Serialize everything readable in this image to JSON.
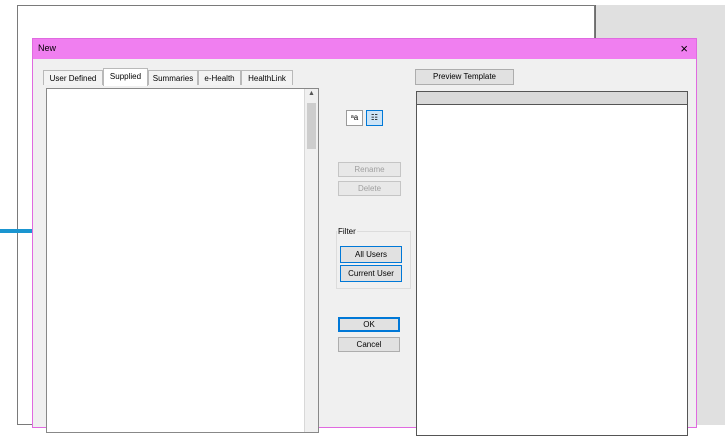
{
  "dialog": {
    "title": "New",
    "close_glyph": "×"
  },
  "tabs": [
    {
      "label": "User Defined",
      "active": false
    },
    {
      "label": "Supplied",
      "active": true
    },
    {
      "label": "Summaries",
      "active": false
    },
    {
      "label": "e-Health",
      "active": false
    },
    {
      "label": "HealthLink",
      "active": false
    }
  ],
  "view_buttons": {
    "sort_alpha": "ᵃa",
    "list_view": "☷"
  },
  "actions": {
    "rename": "Rename",
    "delete": "Delete"
  },
  "filter": {
    "label": "Filter",
    "all_users": "All Users",
    "current_user": "Current User"
  },
  "dialog_buttons": {
    "ok": "OK",
    "cancel": "Cancel"
  },
  "preview": {
    "button": "Preview Template"
  },
  "colors": {
    "titlebar": "#f07ff0",
    "arrow": "#1a95d0"
  }
}
